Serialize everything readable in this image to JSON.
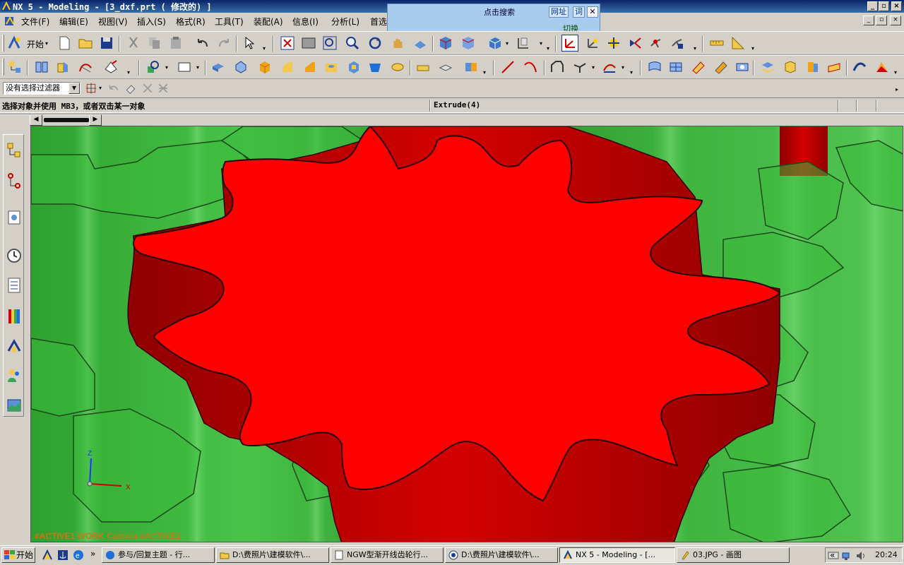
{
  "window": {
    "title": "NX 5 - Modeling - [3_dxf.prt ( 修改的) ]",
    "minimize_icon": "minimize-icon",
    "restore_icon": "restore-icon",
    "close_icon": "close-icon"
  },
  "menubar": {
    "items": [
      {
        "label": "文件(F)"
      },
      {
        "label": "编辑(E)"
      },
      {
        "label": "视图(V)"
      },
      {
        "label": "插入(S)"
      },
      {
        "label": "格式(R)"
      },
      {
        "label": "工具(T)"
      },
      {
        "label": "装配(A)"
      },
      {
        "label": "信息(I)"
      },
      {
        "label": "分析(L)"
      },
      {
        "label": "首选"
      }
    ]
  },
  "search_popup": {
    "title": "点击搜索",
    "link_url": "网址",
    "link_word": "词",
    "close": "✕",
    "switch_label": "切换"
  },
  "toolbar_standard": {
    "start_label": "开始"
  },
  "selection": {
    "filter_value": "没有选择过滤器"
  },
  "cue": {
    "prompt": "选择对象并使用 MB3，或者双击某一对象",
    "status": "Extrude(4)"
  },
  "viewport": {
    "label": "#ACTIVE1 WORK Camera #ACTIVE1",
    "triad_x": "X",
    "triad_z": "Z",
    "colors": {
      "gear_body": "#ff0000",
      "gear_side": "#c00000",
      "background_green": "#2db52d"
    }
  },
  "taskbar": {
    "start_label": "开始",
    "overflow": "»",
    "tasks": [
      {
        "label": "参与/回复主题 - 行..."
      },
      {
        "label": "D:\\费照片\\建模软件\\..."
      },
      {
        "label": "NGW型渐开线齿轮行..."
      },
      {
        "label": "D:\\费照片\\建模软件\\..."
      },
      {
        "label": "NX 5 - Modeling - [..."
      },
      {
        "label": "03.JPG - 画图"
      }
    ],
    "tray_overflow": "«",
    "clock": "20:24"
  }
}
